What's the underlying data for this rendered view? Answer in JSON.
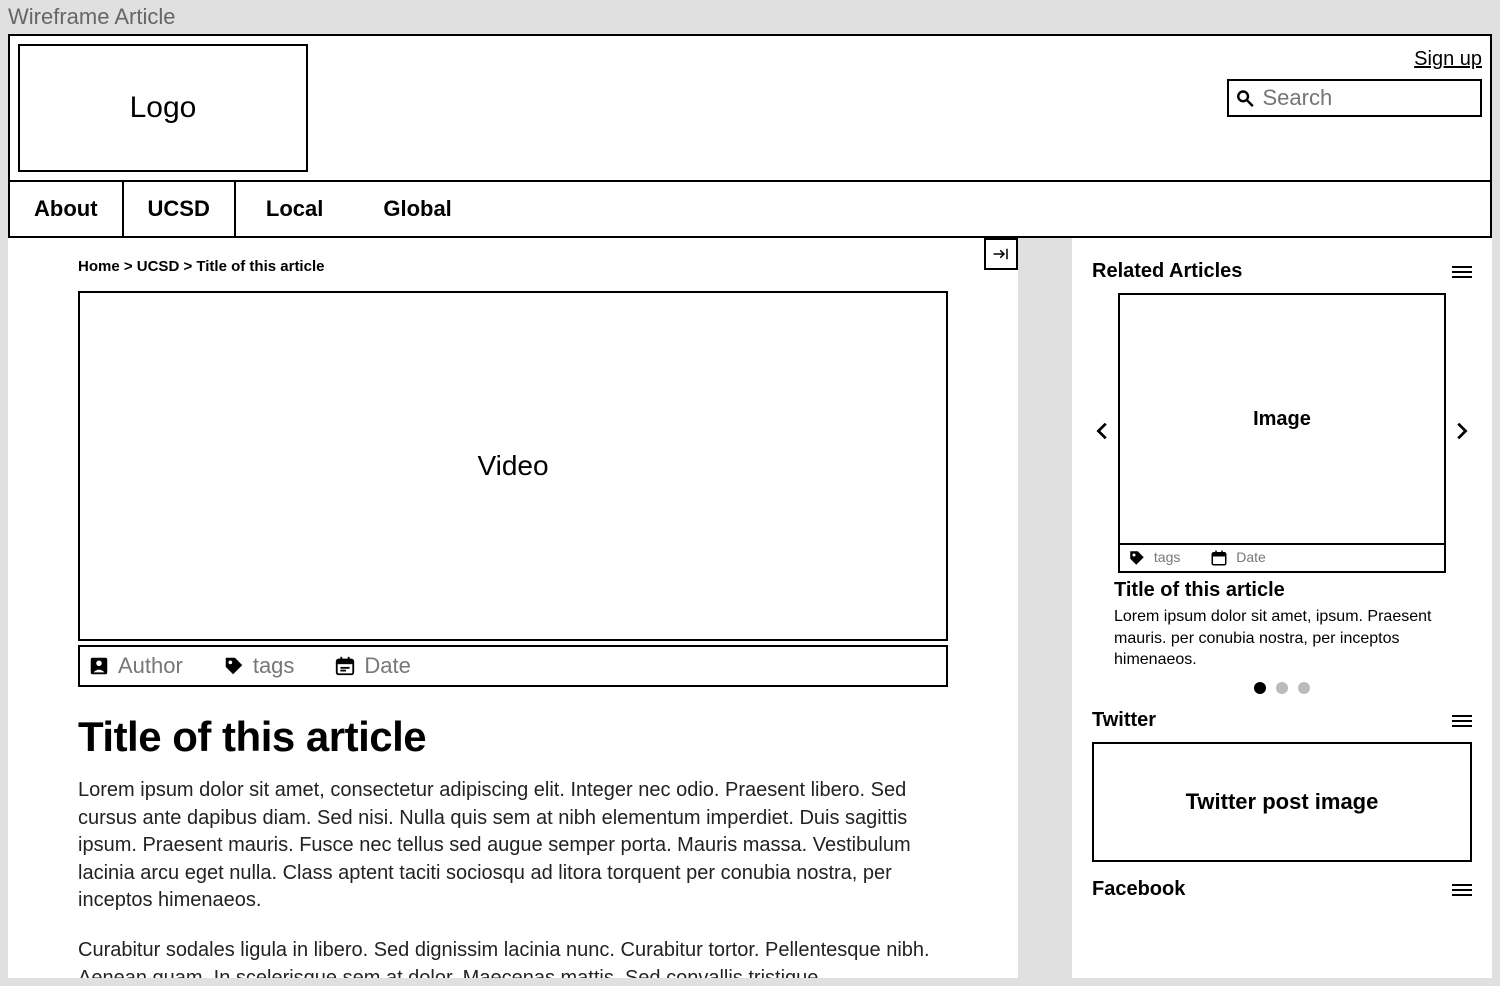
{
  "window_title": "Wireframe Article",
  "header": {
    "logo_label": "Logo",
    "signup_label": "Sign up",
    "search_placeholder": "Search"
  },
  "nav": {
    "items": [
      "About",
      "UCSD",
      "Local",
      "Global"
    ]
  },
  "breadcrumb": "Home > UCSD > Title of this article",
  "video_label": "Video",
  "meta": {
    "author_label": "Author",
    "tags_label": "tags",
    "date_label": "Date"
  },
  "article": {
    "title": "Title of this article",
    "p1": "Lorem ipsum dolor sit amet, consectetur adipiscing elit. Integer nec odio. Praesent libero. Sed cursus ante dapibus diam. Sed nisi. Nulla quis sem at nibh elementum imperdiet. Duis sagittis ipsum. Praesent mauris. Fusce nec tellus sed augue semper porta. Mauris massa. Vestibulum lacinia arcu eget nulla. Class aptent taciti sociosqu ad litora torquent per conubia nostra, per inceptos himenaeos.",
    "p2": "Curabitur sodales ligula in libero. Sed dignissim lacinia nunc. Curabitur tortor. Pellentesque nibh. Aenean quam. In scelerisque sem at dolor. Maecenas mattis. Sed convallis tristique"
  },
  "sidebar": {
    "related_heading": "Related Articles",
    "card": {
      "image_label": "Image",
      "tags_label": "tags",
      "date_label": "Date",
      "title": "Title of this article",
      "desc": "Lorem ipsum dolor sit amet, ipsum. Praesent mauris.  per conubia nostra, per inceptos himenaeos."
    },
    "twitter_heading": "Twitter",
    "twitter_box_label": "Twitter post image",
    "facebook_heading": "Facebook"
  }
}
